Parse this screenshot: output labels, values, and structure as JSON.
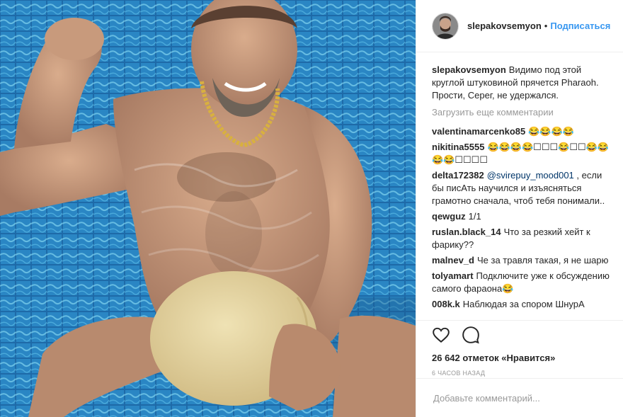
{
  "post": {
    "username": "slepakovsemyon",
    "dot": "•",
    "follow_label": "Подписаться",
    "caption_user": "slepakovsemyon",
    "caption_text": "Видимо под этой круглой штуковиной прячется Pharaoh. Прости, Серег, не удержался.",
    "load_more": "Загрузить еще комментарии",
    "likes": "26 642 отметок «Нравится»",
    "time": "6 ЧАСОВ НАЗАД",
    "add_comment_placeholder": "Добавьте комментарий..."
  },
  "comments": [
    {
      "user": "valentinamarcenko85",
      "text": "😂😂😂😂"
    },
    {
      "user": "nikitina5555",
      "text": "😂😂😂😂☐☐☐😂☐☐😂😂😂😂☐☐☐☐"
    },
    {
      "user": "delta172382",
      "mention": "@svirepuy_mood001",
      "text": ", если бы писАть научился и изъясняться грамотно сначала, чтоб тебя понимали.."
    },
    {
      "user": "qewguz",
      "text": "1/1"
    },
    {
      "user": "ruslan.black_14",
      "text": "Что за резкий хейт к фарику??"
    },
    {
      "user": "malnev_d",
      "text": "Че за травля такая, я не шарю"
    },
    {
      "user": "tolyamart",
      "text": "Подключите уже к обсуждению самого фараона😂"
    },
    {
      "user": "008k.k",
      "text": "Наблюдая за спором ШнурА"
    }
  ],
  "icons": {
    "like": "heart-icon",
    "comment": "speech-bubble-icon"
  },
  "colors": {
    "link": "#3897f0",
    "muted": "#999999",
    "text": "#262626",
    "pool": "#1d6fa8"
  }
}
